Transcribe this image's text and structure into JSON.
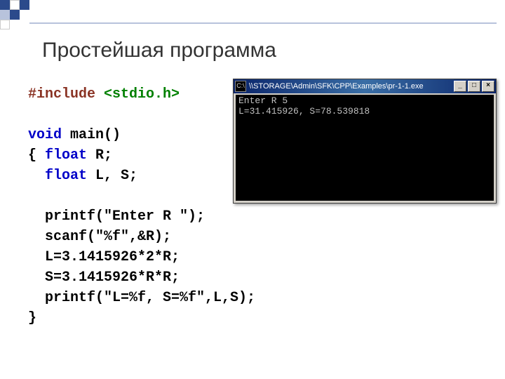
{
  "title": "Простейшая программа",
  "code": {
    "l1a": "#include ",
    "l1b": "<stdio.h>",
    "l3a": "void",
    "l3b": " main()",
    "l4a": "{ ",
    "l4b": "float",
    "l4c": " R;",
    "l5a": "  ",
    "l5b": "float",
    "l5c": " L, S;",
    "l7": "  printf(\"Enter R \");",
    "l8": "  scanf(\"%f\",&R);",
    "l9": "  L=3.1415926*2*R;",
    "l10": "  S=3.1415926*R*R;",
    "l11": "  printf(\"L=%f, S=%f\",L,S);",
    "l12": "}"
  },
  "console": {
    "icon_label": "C:\\",
    "path": "\\\\STORAGE\\Admin\\SFK\\CPP\\Examples\\pr-1-1.exe",
    "btn_min": "_",
    "btn_max": "□",
    "btn_close": "×",
    "line1": "Enter R 5",
    "line2": "L=31.415926, S=78.539818"
  }
}
